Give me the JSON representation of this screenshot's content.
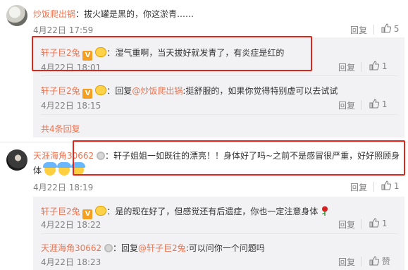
{
  "colors": {
    "username": "#eb7350",
    "text": "#333333",
    "meta": "#808080",
    "reply_bg": "#f2f2f5",
    "highlight": "#e1251b"
  },
  "comments": [
    {
      "username": "炒饭爬出锅",
      "separator": "：",
      "text": "拔火罐是黑的，你这淤青……",
      "date": "4月22日 17:59",
      "reply_label": "回复",
      "likes": "5",
      "replies": [
        {
          "username": "轩子巨2兔",
          "badges": [
            "v-icon",
            "star-badge-icon"
          ],
          "separator": "：",
          "text": "湿气重啊，当天拔好就发青了，有炎症是红的",
          "date": "4月22日 18:01",
          "reply_label": "回复",
          "likes": "1"
        },
        {
          "username": "轩子巨2兔",
          "badges": [
            "v-icon",
            "star-badge-icon"
          ],
          "separator": "：",
          "reply_prefix": "回复",
          "mention": "@炒饭爬出锅",
          "text": ":挺舒服的，如果你觉得特别虚可以去试试",
          "date": "4月22日 18:15",
          "reply_label": "回复",
          "likes": "1"
        }
      ],
      "more_replies": "共4条回复"
    },
    {
      "username": "天涯海角30662",
      "badges": [
        "medal-icon"
      ],
      "separator": "：",
      "text_line1": "轩子姐姐一如既往的漂亮！！身体好了吗~之前不是感冒很严重，好好照顾身",
      "text_line2": "体",
      "emoji": [
        "laugh-cry-icon",
        "laugh-cry-icon",
        "laugh-cry-icon"
      ],
      "date": "4月22日 18:19",
      "reply_label": "回复",
      "likes": "1",
      "replies": [
        {
          "username": "轩子巨2兔",
          "badges": [
            "v-icon",
            "star-badge-icon"
          ],
          "separator": "：",
          "text": "是的现在好了，但感觉还有后遗症，你也一定注意身体",
          "trailing_icon": "rose-icon",
          "date": "4月22日 18:22",
          "reply_label": "回复",
          "likes": "1"
        },
        {
          "username": "天涯海角30662",
          "badges": [
            "medal-icon"
          ],
          "separator": "：",
          "reply_prefix": "回复",
          "mention": "@轩子巨2兔",
          "text": ":可以问你一个问题吗",
          "date": "4月22日 18:23",
          "reply_label": "回复",
          "likes": "赞"
        }
      ]
    }
  ],
  "icons": {
    "thumb": "thumbs-up-icon",
    "v": "V",
    "star": "★"
  }
}
